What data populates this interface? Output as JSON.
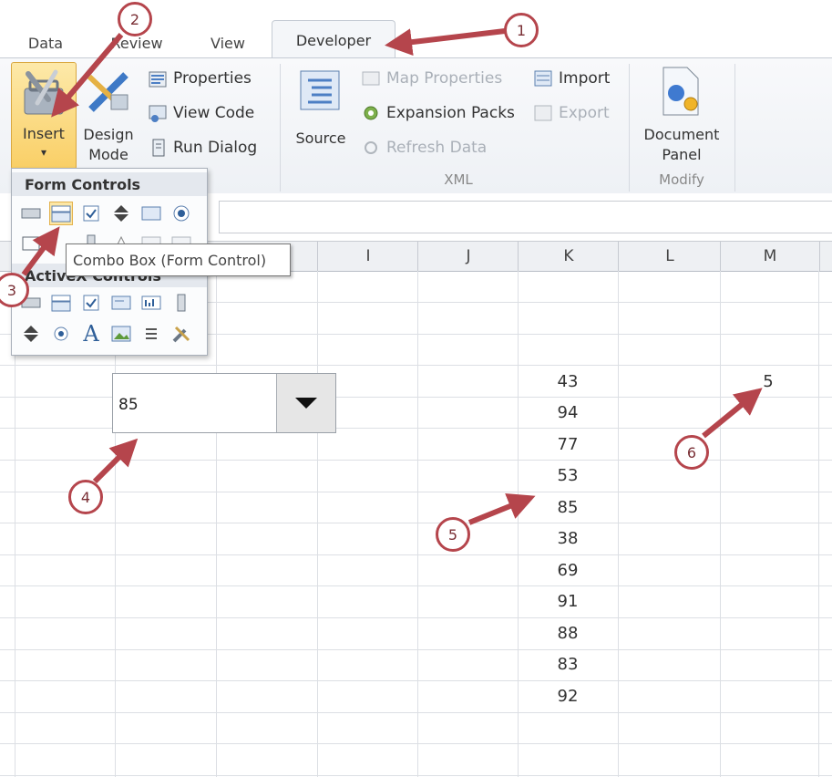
{
  "tabs": [
    {
      "label": "Data",
      "active": false
    },
    {
      "label": "Review",
      "active": false
    },
    {
      "label": "View",
      "active": false
    },
    {
      "label": "Developer",
      "active": true
    }
  ],
  "ribbon": {
    "insert": {
      "label": "Insert",
      "caret": "▾"
    },
    "design_mode": {
      "label_line1": "Design",
      "label_line2": "Mode"
    },
    "properties": "Properties",
    "view_code": "View Code",
    "run_dialog": "Run Dialog",
    "source": "Source",
    "map_properties": "Map Properties",
    "expansion_packs": "Expansion Packs",
    "refresh_data": "Refresh Data",
    "import": "Import",
    "export": "Export",
    "xml_group": "XML",
    "document_panel": {
      "line1": "Document",
      "line2": "Panel"
    },
    "modify_group": "Modify"
  },
  "insert_panel": {
    "form_controls_header": "Form Controls",
    "activex_controls_header": "ActiveX Controls",
    "tooltip": "Combo Box (Form Control)"
  },
  "columns": [
    "I",
    "J",
    "K",
    "L",
    "M"
  ],
  "combo_box": {
    "value": "85"
  },
  "column_k_values": [
    "43",
    "94",
    "77",
    "53",
    "85",
    "38",
    "69",
    "91",
    "88",
    "83",
    "92"
  ],
  "column_m_value": "5",
  "callouts": [
    "1",
    "2",
    "3",
    "4",
    "5",
    "6"
  ],
  "colors": {
    "callout": "#b5454c",
    "selected_control": "#fde7a5"
  }
}
